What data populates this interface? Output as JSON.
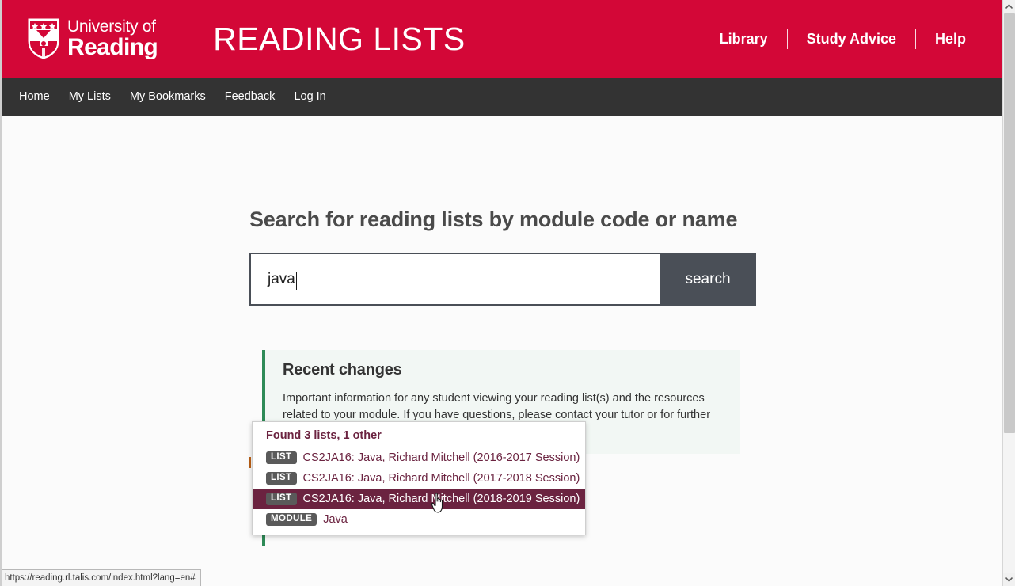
{
  "browser": {
    "status_bar_url": "https://reading.rl.talis.com/index.html?lang=en#"
  },
  "masthead": {
    "logo_line1": "University of",
    "logo_line2": "Reading",
    "logo_icon": "university-crest-icon",
    "site_title": "READING LISTS",
    "brand_color": "#d30737",
    "links": [
      {
        "label": "Library"
      },
      {
        "label": "Study Advice"
      },
      {
        "label": "Help"
      }
    ]
  },
  "navbar": {
    "background_color": "#333333",
    "items": [
      {
        "label": "Home"
      },
      {
        "label": "My Lists"
      },
      {
        "label": "My Bookmarks"
      },
      {
        "label": "Feedback"
      },
      {
        "label": "Log In"
      }
    ]
  },
  "search": {
    "heading": "Search for reading lists by module code or name",
    "value": "java",
    "placeholder": "",
    "button_label": "search",
    "button_color": "#4a4f57"
  },
  "autocomplete": {
    "heading": "Found 3 lists, 1 other",
    "highlight_color": "#6b2340",
    "items": [
      {
        "badge": "LIST",
        "label": "CS2JA16: Java, Richard Mitchell (2016-2017 Session)",
        "selected": false
      },
      {
        "badge": "LIST",
        "label": "CS2JA16: Java, Richard Mitchell (2017-2018 Session)",
        "selected": false
      },
      {
        "badge": "LIST",
        "label": "CS2JA16: Java, Richard Mitchell (2018-2019 Session)",
        "selected": true
      },
      {
        "badge": "MODULE",
        "label": "Java",
        "selected": false
      }
    ]
  },
  "notice": {
    "accent_color": "#2e8b57",
    "background_color": "#f2f7f4",
    "heading": "Recent changes",
    "body": "Important information for any student viewing your reading list(s) and the resources related to your module. If you have questions, please contact your tutor or for further guidance."
  }
}
